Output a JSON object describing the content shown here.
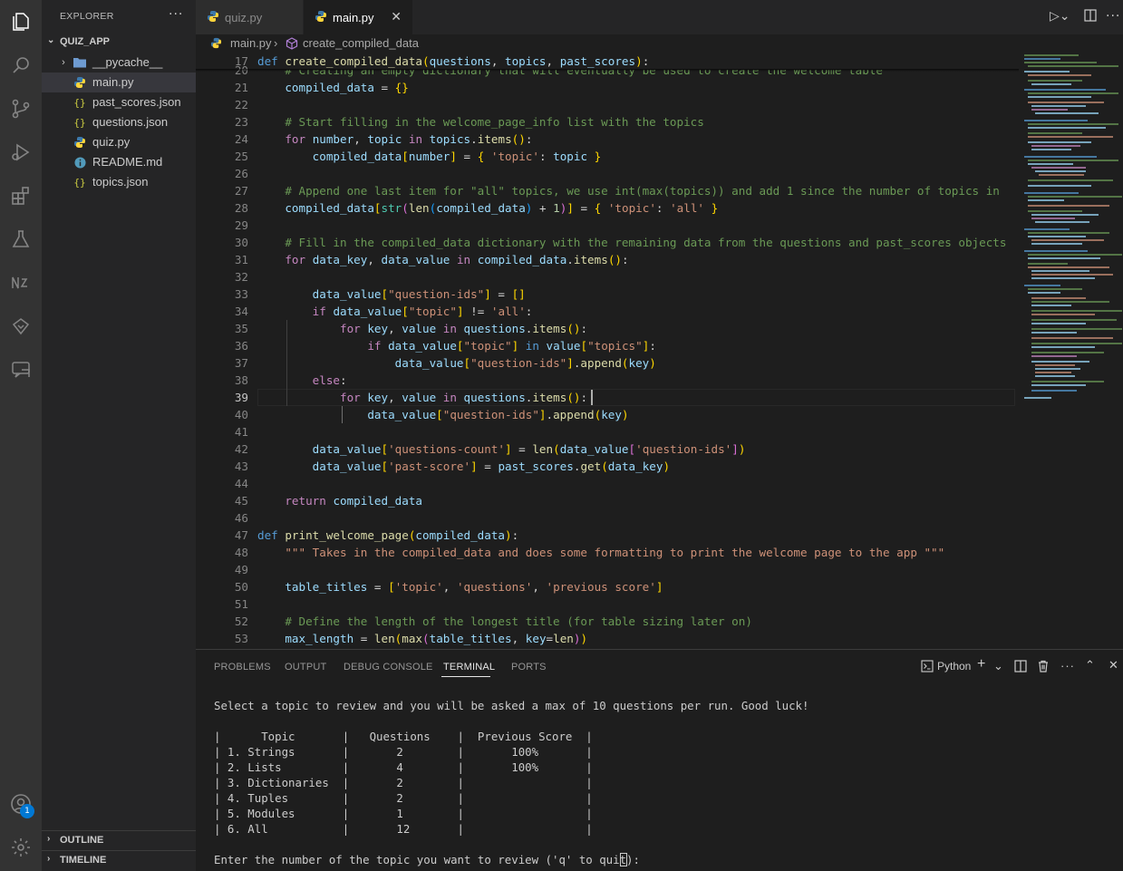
{
  "activity_bar": {
    "icons": [
      "explorer-icon",
      "search-icon",
      "source-control-icon",
      "run-debug-icon",
      "extensions-icon",
      "testing-icon",
      "notebook-icon",
      "remote-icon",
      "chat-icon"
    ],
    "accounts_badge": "1"
  },
  "sidebar": {
    "title": "EXPLORER",
    "more": "···",
    "folder": "QUIZ_APP",
    "items": [
      {
        "label": "__pycache__",
        "type": "folder"
      },
      {
        "label": "main.py",
        "type": "python"
      },
      {
        "label": "past_scores.json",
        "type": "json"
      },
      {
        "label": "questions.json",
        "type": "json"
      },
      {
        "label": "quiz.py",
        "type": "python"
      },
      {
        "label": "README.md",
        "type": "info"
      },
      {
        "label": "topics.json",
        "type": "json"
      }
    ],
    "outline": "OUTLINE",
    "timeline": "TIMELINE"
  },
  "tabs": [
    {
      "label": "quiz.py",
      "active": false
    },
    {
      "label": "main.py",
      "active": true
    }
  ],
  "breadcrumb": {
    "file": "main.py",
    "symbol": "create_compiled_data"
  },
  "editor": {
    "sticky_line": {
      "number": "17",
      "text": "def create_compiled_data(questions, topics, past_scores):"
    },
    "hidden_line_text": "    # Creating an empty dictionary that will eventually be used to create the welcome table",
    "line_numbers": [
      "20",
      "21",
      "22",
      "23",
      "24",
      "25",
      "26",
      "27",
      "28",
      "29",
      "30",
      "31",
      "32",
      "33",
      "34",
      "35",
      "36",
      "37",
      "38",
      "39",
      "40",
      "41",
      "42",
      "43",
      "44",
      "45",
      "46",
      "47",
      "48",
      "49",
      "50",
      "51",
      "52",
      "53"
    ],
    "current_line": "39"
  },
  "panel": {
    "tabs": [
      "PROBLEMS",
      "OUTPUT",
      "DEBUG CONSOLE",
      "TERMINAL",
      "PORTS"
    ],
    "active_tab": "TERMINAL",
    "shell": "Python",
    "terminal_lines": [
      "Select a topic to review and you will be asked a max of 10 questions per run. Good luck!",
      "",
      "|      Topic       |   Questions    |  Previous Score  |",
      "| 1. Strings       |       2        |       100%       |",
      "| 2. Lists         |       4        |       100%       |",
      "| 3. Dictionaries  |       2        |                  |",
      "| 4. Tuples        |       2        |                  |",
      "| 5. Modules       |       1        |                  |",
      "| 6. All           |       12       |                  |",
      "",
      "Enter the number of the topic you want to review ('q' to quit): "
    ]
  },
  "colors": {
    "keyword": "#569cd6",
    "control": "#c586c0",
    "comment": "#6a9955",
    "string": "#ce9178",
    "number": "#b5cea8",
    "function": "#dcdcaa",
    "variable": "#9cdcfe",
    "accent": "#0078d4"
  }
}
